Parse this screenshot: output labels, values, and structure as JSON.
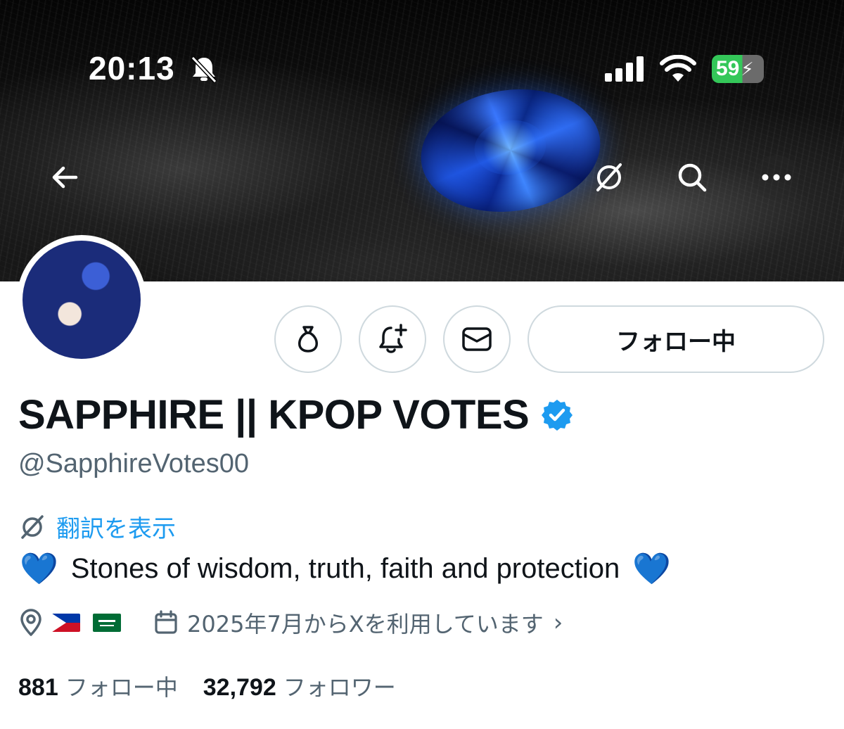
{
  "status_bar": {
    "time": "20:13",
    "battery_level": "59",
    "battery_color": "#34c759"
  },
  "banner_nav": {
    "back_icon": "arrow-left-icon",
    "translate_icon": "translate-globe-icon",
    "search_icon": "search-icon",
    "more_icon": "more-horizontal-icon"
  },
  "actions": {
    "tip_icon": "money-bag-icon",
    "notify_icon": "bell-plus-icon",
    "message_icon": "envelope-icon",
    "follow_label": "フォロー中"
  },
  "profile": {
    "display_name": "SAPPHIRE || KPOP VOTES",
    "verified_color": "#1d9bf0",
    "handle": "@SapphireVotes00",
    "translate_label": "翻訳を表示",
    "bio_text": "Stones of wisdom, truth, faith and protection",
    "bio_emoji_left": "💙",
    "bio_emoji_right": "💙",
    "location_flags": [
      "philippines-flag",
      "saudi-arabia-flag"
    ],
    "joined": "2025年7月からXを利用しています"
  },
  "counts": {
    "following_count": "881",
    "following_label": "フォロー中",
    "followers_count": "32,792",
    "followers_label": "フォロワー"
  },
  "colors": {
    "link_blue": "#1d9bf0",
    "secondary_text": "#536471",
    "border": "#cfd9de"
  }
}
